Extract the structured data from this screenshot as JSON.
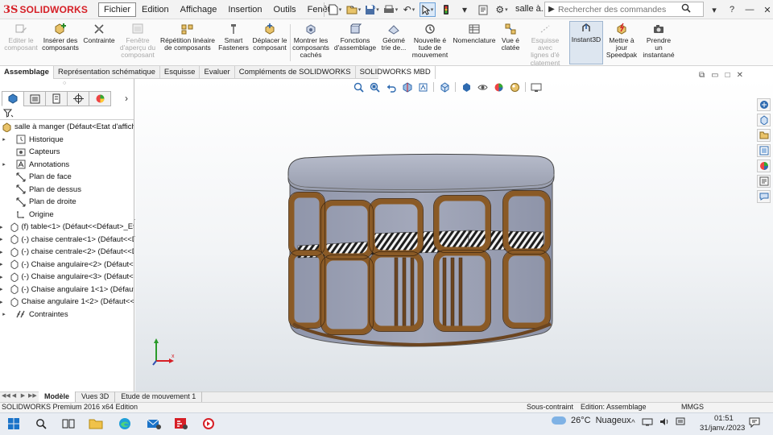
{
  "app": {
    "logo_prefix": "3S",
    "logo_name": "SOLIDWORKS"
  },
  "menus": [
    "Fichier",
    "Edition",
    "Affichage",
    "Insertion",
    "Outils",
    "Fenêtre",
    "?"
  ],
  "document_name": "salle à...",
  "search": {
    "placeholder": "Rechercher des commandes"
  },
  "ribbon": [
    {
      "label": "Editer le\ncomposant",
      "disabled": true,
      "icon": "edit-component-icon"
    },
    {
      "label": "Insérer des\ncomposants",
      "disabled": false,
      "icon": "insert-components-icon"
    },
    {
      "label": "Contrainte",
      "disabled": false,
      "icon": "mate-icon"
    },
    {
      "label": "Fenêtre\nd'aperçu du\ncomposant",
      "disabled": true,
      "icon": "preview-window-icon"
    },
    {
      "label": "Répétition linéaire\nde composants",
      "disabled": false,
      "icon": "linear-pattern-icon"
    },
    {
      "label": "Smart\nFasteners",
      "disabled": false,
      "icon": "smart-fasteners-icon"
    },
    {
      "label": "Déplacer le\ncomposant",
      "disabled": false,
      "icon": "move-component-icon"
    },
    {
      "label": "Montrer les\ncomposants\ncachés",
      "disabled": false,
      "icon": "show-hidden-icon"
    },
    {
      "label": "Fonctions\nd'assemblage",
      "disabled": false,
      "icon": "assembly-features-icon"
    },
    {
      "label": "Géomé\ntrie de...",
      "disabled": false,
      "icon": "reference-geometry-icon"
    },
    {
      "label": "Nouvelle é\ntude de\nmouvement",
      "disabled": false,
      "icon": "motion-study-icon"
    },
    {
      "label": "Nomenclature",
      "disabled": false,
      "icon": "bom-icon"
    },
    {
      "label": "Vue é\nclatée",
      "disabled": false,
      "icon": "exploded-view-icon"
    },
    {
      "label": "Esquisse avec\nlignes d'é\nclatement",
      "disabled": true,
      "icon": "explode-line-icon"
    },
    {
      "label": "Instant3D",
      "disabled": false,
      "active": true,
      "icon": "instant3d-icon"
    },
    {
      "label": "Mettre à\njour\nSpeedpak",
      "disabled": false,
      "icon": "speedpak-icon"
    },
    {
      "label": "Prendre\nun\ninstantané",
      "disabled": false,
      "icon": "snapshot-icon"
    }
  ],
  "tabs": [
    "Assemblage",
    "Représentation schématique",
    "Esquisse",
    "Evaluer",
    "Compléments de SOLIDWORKS",
    "SOLIDWORKS MBD"
  ],
  "tree": [
    {
      "label": "salle à manger  (Défaut<Etat d'affichage",
      "arrow": false,
      "icon": "assembly-icon",
      "indent": 0
    },
    {
      "label": "Historique",
      "arrow": true,
      "icon": "history-icon",
      "indent": 1
    },
    {
      "label": "Capteurs",
      "arrow": false,
      "icon": "sensors-icon",
      "indent": 1
    },
    {
      "label": "Annotations",
      "arrow": true,
      "icon": "annotations-icon",
      "indent": 1
    },
    {
      "label": "Plan de face",
      "arrow": false,
      "icon": "plane-icon",
      "indent": 1
    },
    {
      "label": "Plan de dessus",
      "arrow": false,
      "icon": "plane-icon",
      "indent": 1
    },
    {
      "label": "Plan de droite",
      "arrow": false,
      "icon": "plane-icon",
      "indent": 1
    },
    {
      "label": "Origine",
      "arrow": false,
      "icon": "origin-icon",
      "indent": 1
    },
    {
      "label": "(f) table<1> (Défaut<<Défaut>_Etat",
      "arrow": true,
      "icon": "part-icon",
      "indent": 1
    },
    {
      "label": "(-) chaise centrale<1> (Défaut<<Dé",
      "arrow": true,
      "icon": "part-icon",
      "indent": 1
    },
    {
      "label": "(-) chaise centrale<2> (Défaut<<Dé",
      "arrow": true,
      "icon": "part-icon",
      "indent": 1
    },
    {
      "label": "(-) Chaise angulaire<2> (Défaut<<D",
      "arrow": true,
      "icon": "part-icon",
      "indent": 1
    },
    {
      "label": "(-) Chaise angulaire<3> (Défaut<<D",
      "arrow": true,
      "icon": "part-icon",
      "indent": 1
    },
    {
      "label": "(-) Chaise angulaire 1<1> (Défaut<-",
      "arrow": true,
      "icon": "part-icon",
      "indent": 1
    },
    {
      "label": "Chaise angulaire 1<2> (Défaut<<De",
      "arrow": true,
      "icon": "part-icon",
      "indent": 1
    },
    {
      "label": "Contraintes",
      "arrow": true,
      "icon": "mates-icon",
      "indent": 1
    }
  ],
  "bottom_tabs": [
    "Modèle",
    "Vues 3D",
    "Etude de mouvement 1"
  ],
  "status": {
    "edition": "SOLIDWORKS Premium 2016 x64 Edition",
    "constraint": "Sous-contraint",
    "editing": "Edition: Assemblage",
    "units": "MMGS"
  },
  "taskbar": {
    "temperature": "26°C",
    "condition": "Nuageux",
    "time": "01:51",
    "date": "31/janv./2023"
  },
  "colors": {
    "brand_red": "#d61f26",
    "wood": "#8a5a26",
    "table_top": "#9da3b3",
    "accent_blue": "#2f6bb0"
  }
}
